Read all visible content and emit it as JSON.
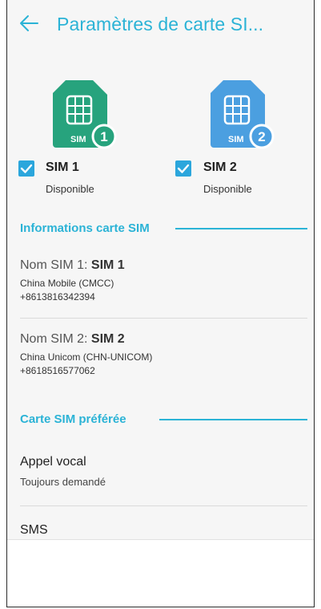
{
  "header": {
    "title": "Paramètres de carte SI..."
  },
  "sims": [
    {
      "card_label": "SIM",
      "badge": "1",
      "name": "SIM 1",
      "status": "Disponible",
      "color": "#27a37d"
    },
    {
      "card_label": "SIM",
      "badge": "2",
      "name": "SIM 2",
      "status": "Disponible",
      "color": "#4b9fe0"
    }
  ],
  "info_section": {
    "title": "Informations carte SIM",
    "items": [
      {
        "label": "Nom SIM 1: ",
        "name": "SIM 1",
        "carrier": "China Mobile (CMCC)",
        "number": "+8613816342394"
      },
      {
        "label": "Nom SIM 2: ",
        "name": "SIM 2",
        "carrier": "China Unicom (CHN-UNICOM)",
        "number": "+8618516577062"
      }
    ]
  },
  "preferred_section": {
    "title": "Carte SIM préférée",
    "items": [
      {
        "title": "Appel vocal",
        "subtitle": "Toujours demandé"
      },
      {
        "title": "SMS"
      }
    ]
  },
  "colors": {
    "accent": "#2bb3d6",
    "checkbox": "#2ba6dc"
  }
}
